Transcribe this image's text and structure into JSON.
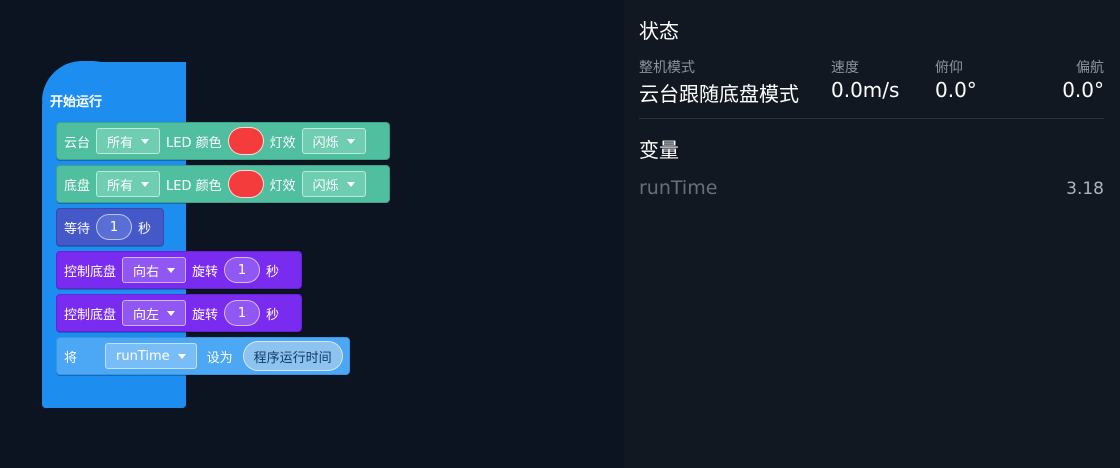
{
  "blocks": {
    "start": "开始运行",
    "gimbal_led": {
      "target_label": "云台",
      "target": "所有",
      "led_label": "LED 颜色",
      "effect_label": "灯效",
      "effect": "闪烁",
      "color": "#f43c3c"
    },
    "chassis_led": {
      "target_label": "底盘",
      "target": "所有",
      "led_label": "LED 颜色",
      "effect_label": "灯效",
      "effect": "闪烁",
      "color": "#f43c3c"
    },
    "wait": {
      "label": "等待",
      "value": "1",
      "unit": "秒"
    },
    "rotate_right": {
      "label": "控制底盘",
      "direction": "向右",
      "action": "旋转",
      "value": "1",
      "unit": "秒"
    },
    "rotate_left": {
      "label": "控制底盘",
      "direction": "向左",
      "action": "旋转",
      "value": "1",
      "unit": "秒"
    },
    "set_var": {
      "label": "将",
      "variable": "runTime",
      "set_label": "设为",
      "value": "程序运行时间"
    }
  },
  "status": {
    "title": "状态",
    "mode_label": "整机模式",
    "mode_value": "云台跟随底盘模式",
    "speed_label": "速度",
    "speed_value": "0.0m/s",
    "pitch_label": "俯仰",
    "pitch_value": "0.0°",
    "yaw_label": "偏航",
    "yaw_value": "0.0°"
  },
  "variables": {
    "title": "变量",
    "items": [
      {
        "name": "runTime",
        "value": "3.18"
      }
    ]
  }
}
